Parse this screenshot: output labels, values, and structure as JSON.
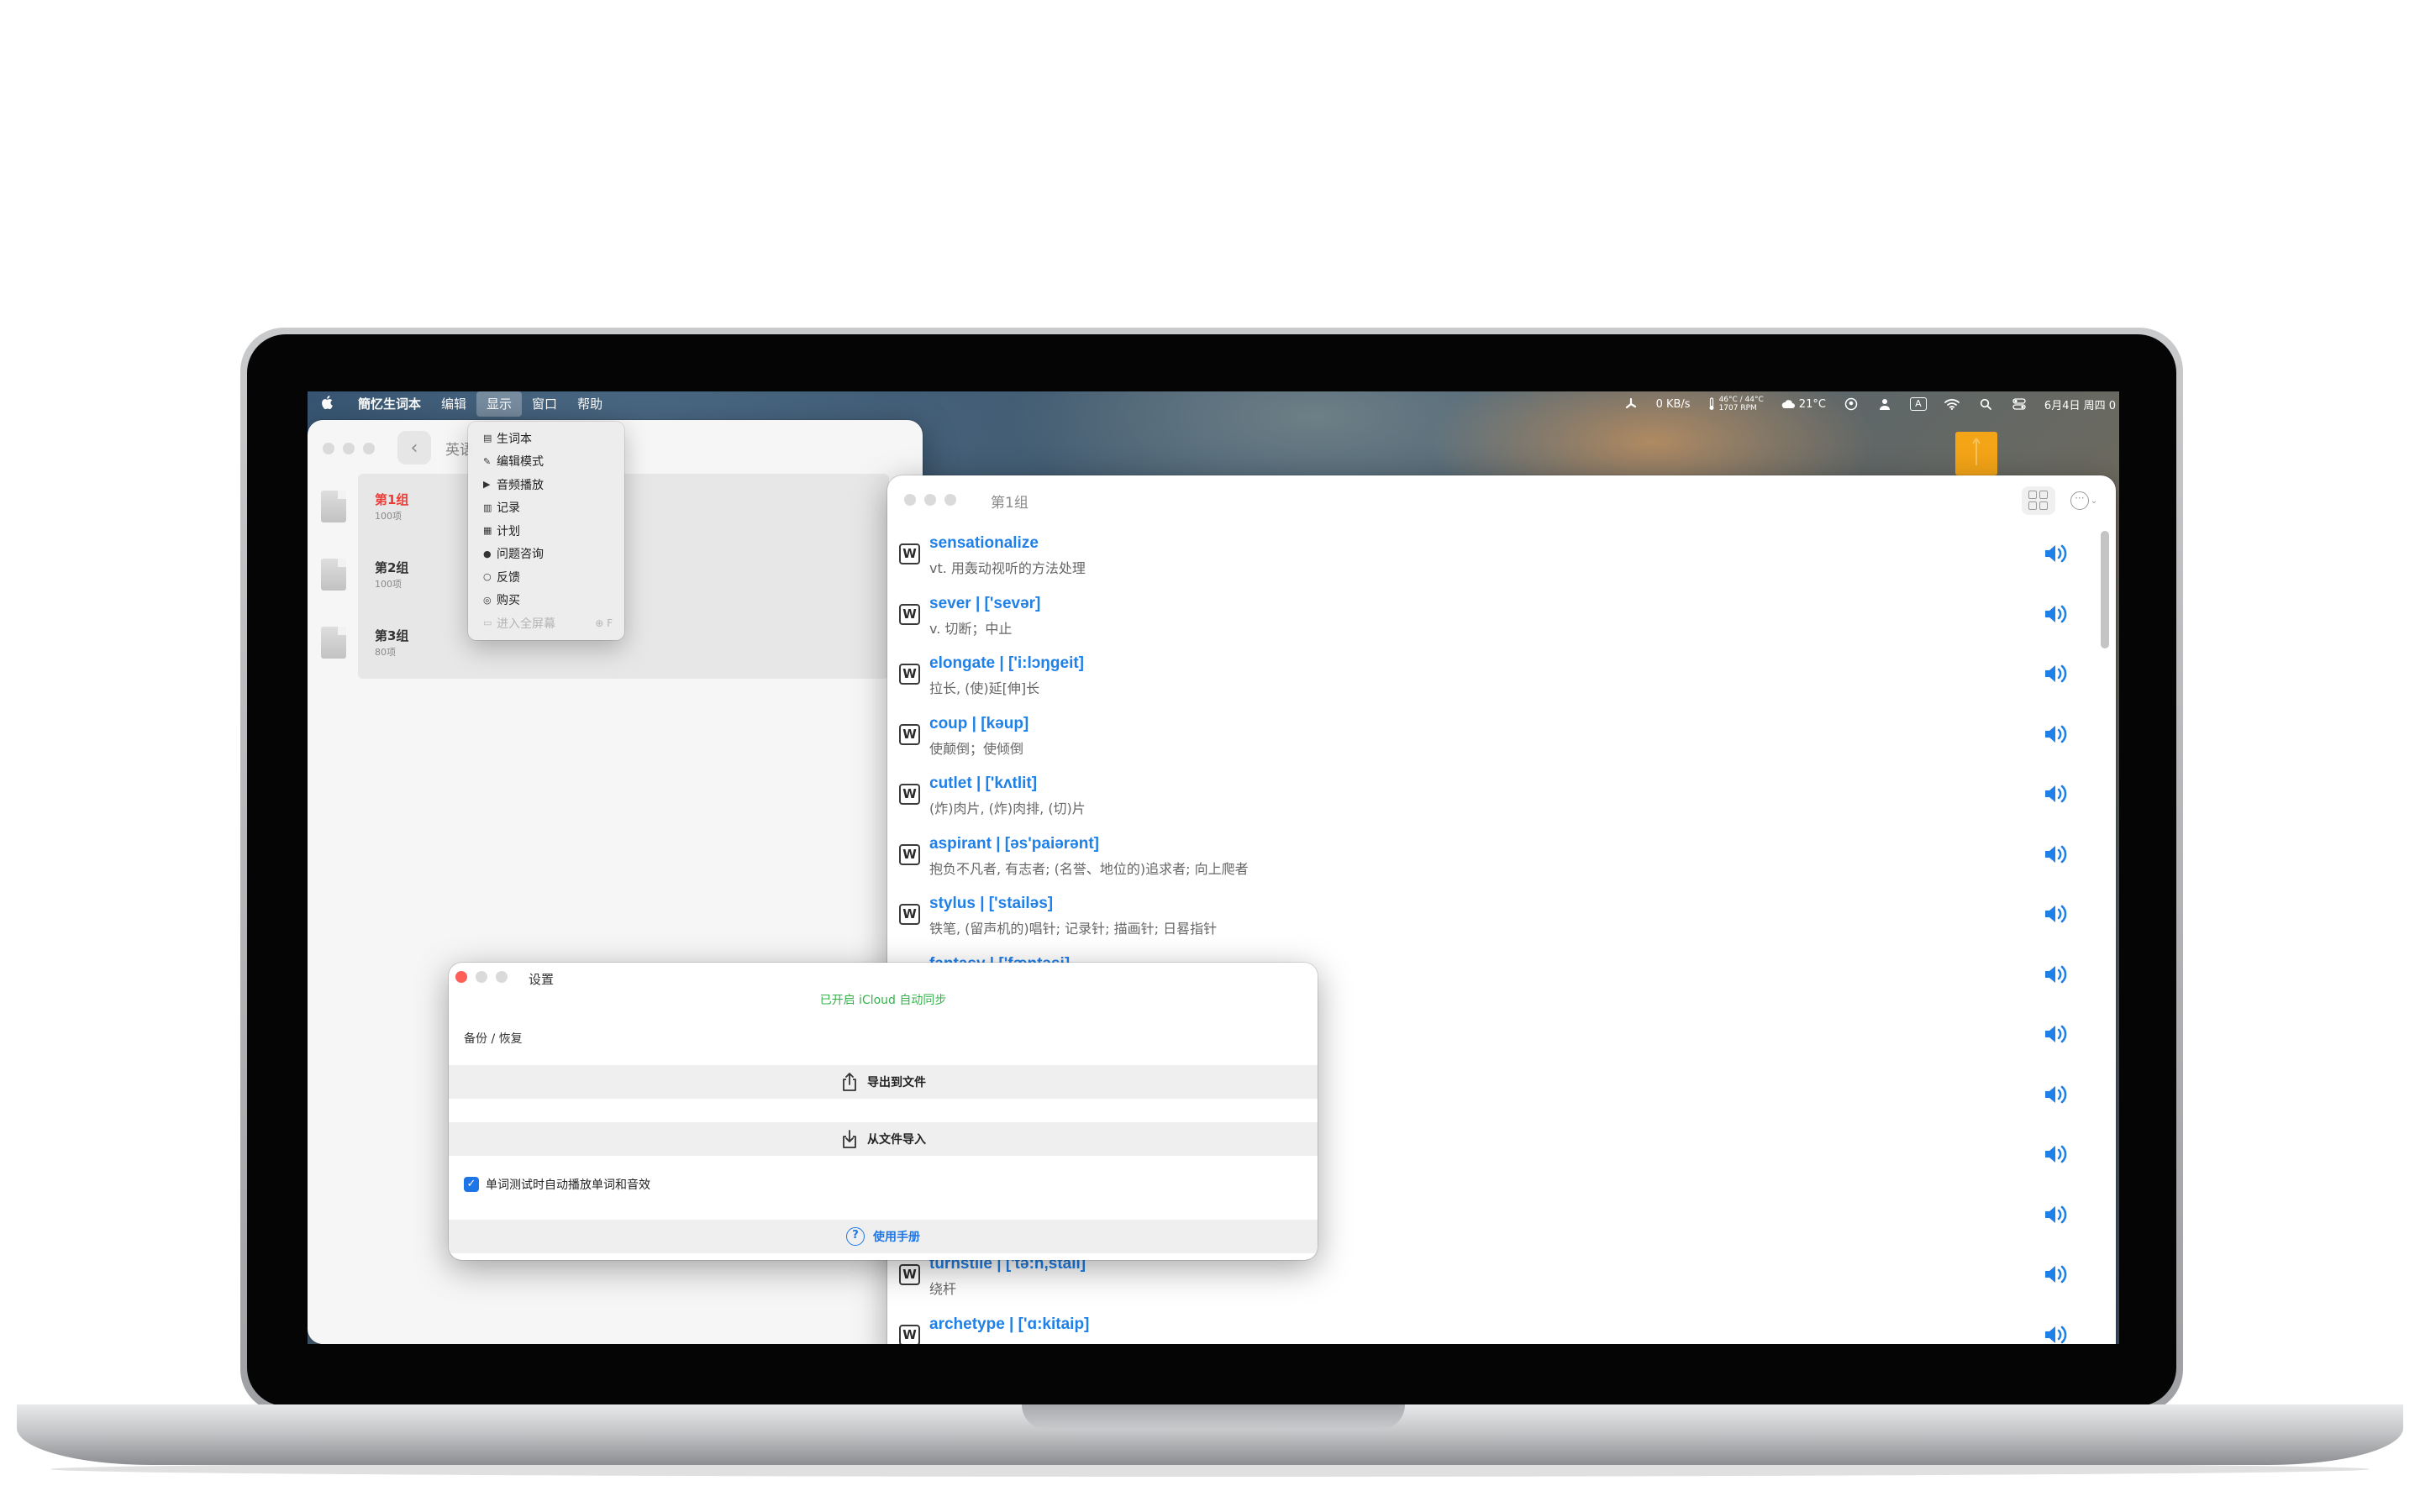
{
  "menubar": {
    "app_name": "簡忆生词本",
    "items": [
      "编辑",
      "显示",
      "窗口",
      "帮助"
    ],
    "status": {
      "net_speed": "0 KB/s",
      "temp": "46°C / 44°C",
      "fan": "1707 RPM",
      "weather": "21°C",
      "input_method": "A",
      "datetime": "6月4日 周四 0"
    },
    "icons": [
      "apple-icon",
      "fan-icon",
      "thermometer-icon",
      "cloud-icon",
      "user-circle-icon",
      "person-icon",
      "input-method-icon",
      "wifi-icon",
      "search-icon",
      "control-center-icon"
    ]
  },
  "dropdown": {
    "items": [
      {
        "label": "生词本",
        "icon": "book-icon",
        "enabled": true
      },
      {
        "label": "编辑模式",
        "icon": "edit-icon",
        "enabled": true
      },
      {
        "label": "音频播放",
        "icon": "play-icon",
        "enabled": true
      },
      {
        "label": "记录",
        "icon": "record-icon",
        "enabled": true
      },
      {
        "label": "计划",
        "icon": "calendar-icon",
        "enabled": true
      },
      {
        "label": "问题咨询",
        "icon": "question-icon",
        "enabled": true
      },
      {
        "label": "反馈",
        "icon": "feedback-icon",
        "enabled": true
      },
      {
        "label": "购买",
        "icon": "purchase-icon",
        "enabled": true
      },
      {
        "label": "进入全屏幕",
        "icon": "fullscreen-icon",
        "enabled": false,
        "shortcut": "⊕ F"
      }
    ]
  },
  "left_window": {
    "title": "英语",
    "groups": [
      {
        "name": "第1组",
        "count": "100项",
        "selected": true
      },
      {
        "name": "第2组",
        "count": "100项",
        "selected": false
      },
      {
        "name": "第3组",
        "count": "80项",
        "selected": false
      }
    ]
  },
  "right_window": {
    "title": "第1组",
    "words": [
      {
        "word": "sensationalize",
        "def": "vt. 用轰动视听的方法处理"
      },
      {
        "word": "sever | ['sevər]",
        "def": "v. 切断；中止"
      },
      {
        "word": "elongate | ['i:lɔŋgeit]",
        "def": "拉长, (使)延[伸]长"
      },
      {
        "word": "coup | [kəup]",
        "def": "使颠倒；使倾倒"
      },
      {
        "word": "cutlet | ['kʌtlit]",
        "def": "(炸)肉片, (炸)肉排, (切)片"
      },
      {
        "word": "aspirant | [əs'paiərənt]",
        "def": "抱负不凡者, 有志者; (名誉、地位的)追求者; 向上爬者"
      },
      {
        "word": "stylus | ['stailəs]",
        "def": "铁笔, (留声机的)唱针; 记录针; 描画针; 日晷指针"
      },
      {
        "word": "fantasy | ['fæntəsi]",
        "def": ""
      },
      {
        "word": "",
        "def": ""
      },
      {
        "word": "",
        "def": ""
      },
      {
        "word": "",
        "def": ""
      },
      {
        "word": "",
        "def": ""
      },
      {
        "word": "turnstile | ['tə:n,stail]",
        "def": "绕杆"
      },
      {
        "word": "archetype | ['ɑ:kitaip]",
        "def": ""
      }
    ]
  },
  "settings": {
    "title": "设置",
    "sync_status": "已开启 iCloud 自动同步",
    "section_label": "备份 / 恢复",
    "export_label": "导出到文件",
    "import_label": "从文件导入",
    "autoplay_label": "单词测试时自动播放单词和音效",
    "autoplay_checked": true,
    "help_label": "使用手册"
  },
  "colors": {
    "accent": "#1f80e8",
    "sync_green": "#33b34a",
    "selected_group": "#ee3b36",
    "close_red": "#fe5f57",
    "orange_tag": "#f3a417"
  }
}
